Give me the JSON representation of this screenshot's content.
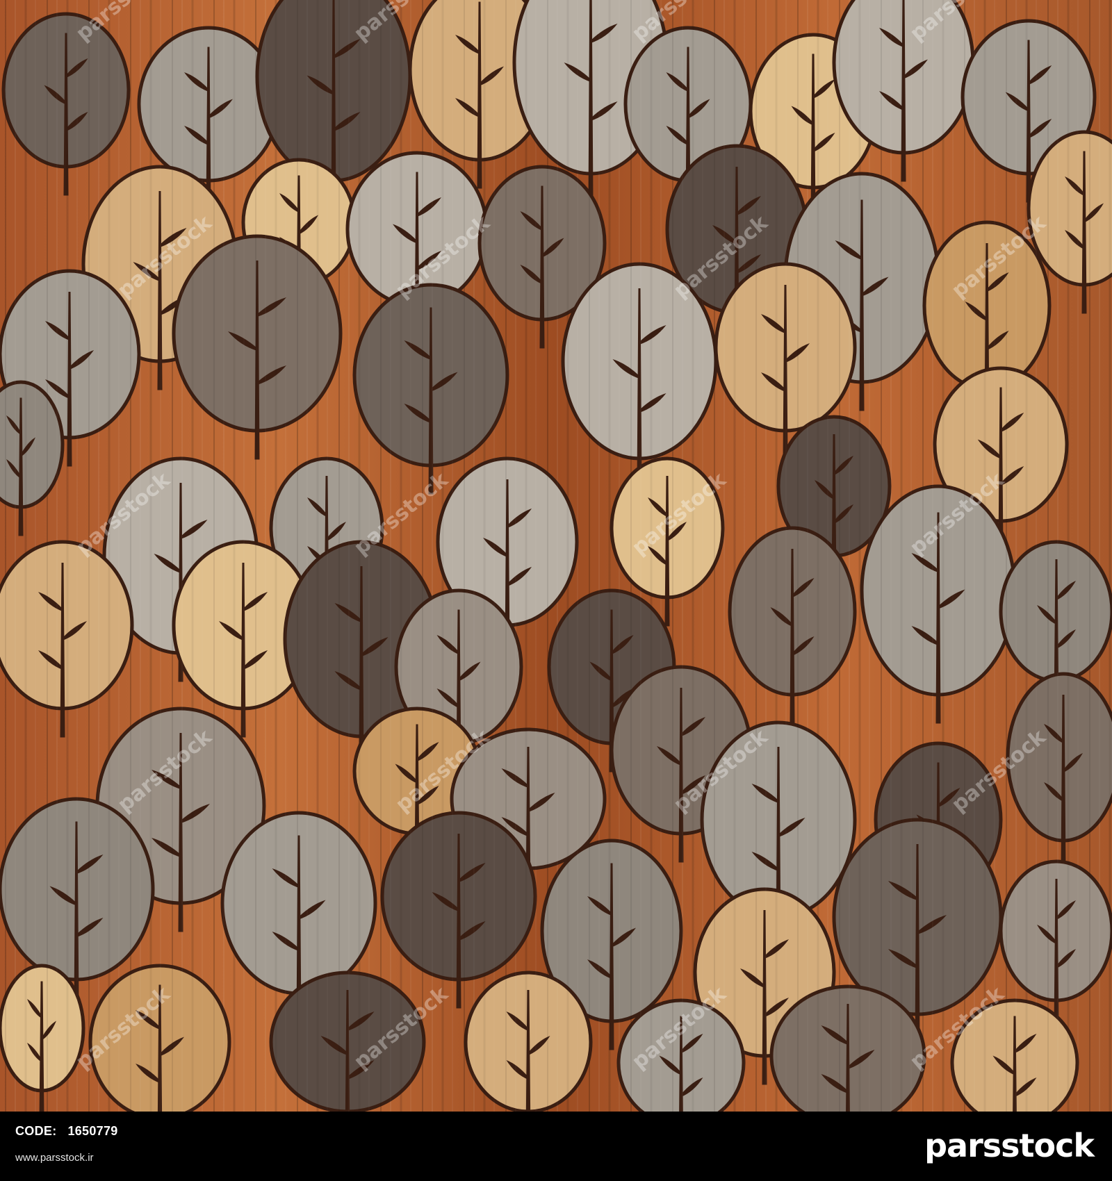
{
  "footer": {
    "code_label": "CODE:",
    "code_value": "1650779",
    "website": "www.parsstock.ir",
    "brand": "parsstock"
  },
  "watermark": {
    "text": "parsstock"
  },
  "colors": {
    "background_wood": "#b5602b",
    "grey_wood": "#a39c92",
    "dark_wood": "#6e6259",
    "pale_wood": "#d4ad7c",
    "outline": "#3a1e12",
    "footer": "#000000"
  }
}
